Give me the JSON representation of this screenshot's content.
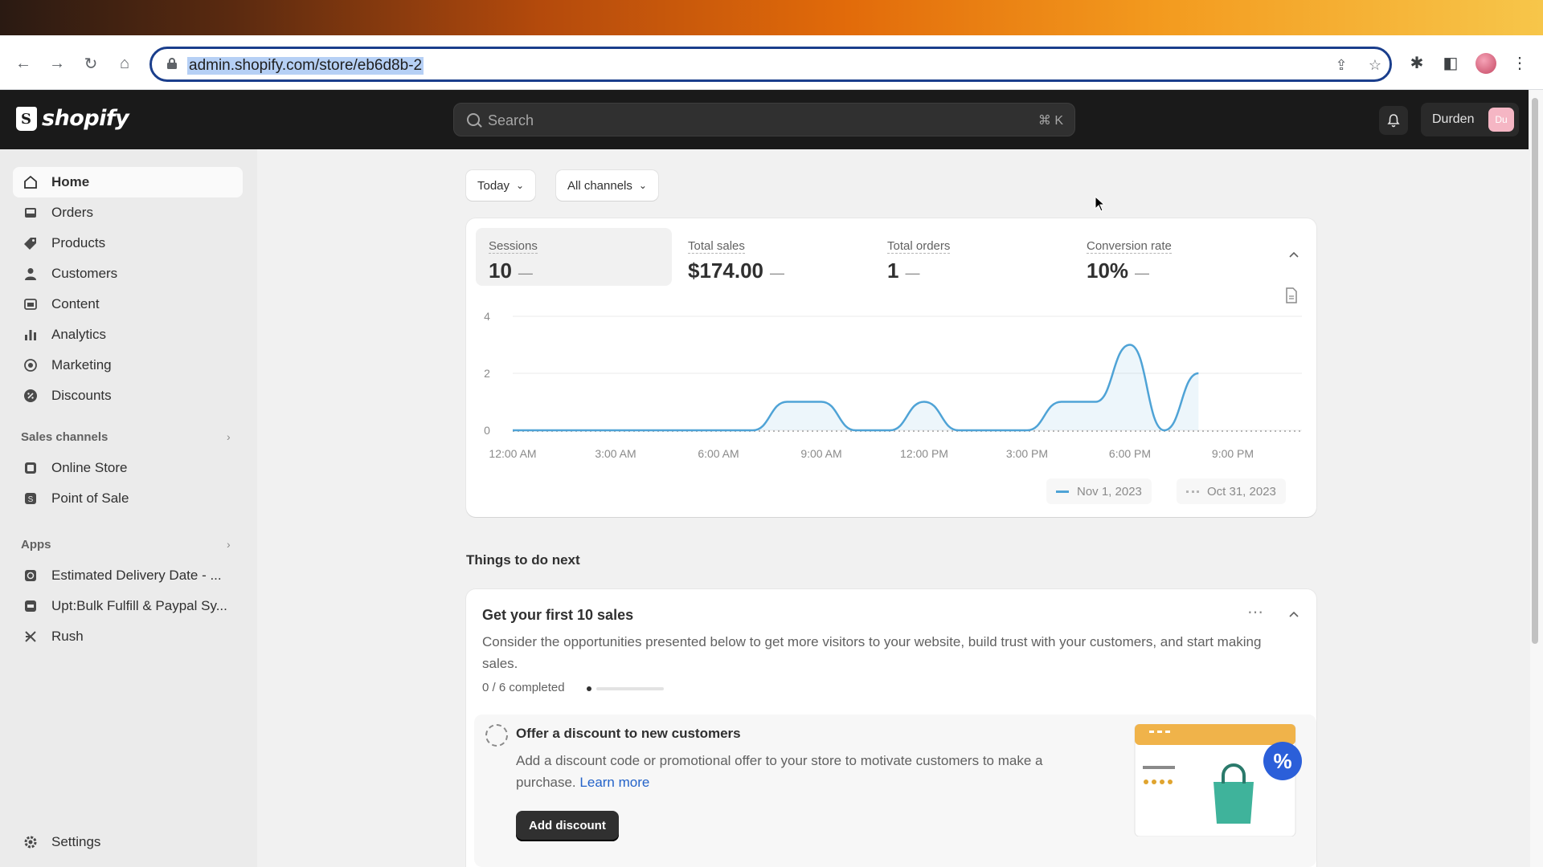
{
  "browser": {
    "url": "admin.shopify.com/store/eb6d8b-2"
  },
  "topbar": {
    "brand": "shopify",
    "search_placeholder": "Search",
    "search_shortcut": "⌘ K",
    "user_name": "Durden",
    "user_initials": "Du"
  },
  "sidebar": {
    "items": [
      {
        "label": "Home",
        "icon": "home-icon"
      },
      {
        "label": "Orders",
        "icon": "inbox-icon"
      },
      {
        "label": "Products",
        "icon": "tag-icon"
      },
      {
        "label": "Customers",
        "icon": "person-icon"
      },
      {
        "label": "Content",
        "icon": "content-icon"
      },
      {
        "label": "Analytics",
        "icon": "bar-chart-icon"
      },
      {
        "label": "Marketing",
        "icon": "target-icon"
      },
      {
        "label": "Discounts",
        "icon": "discount-icon"
      }
    ],
    "sales_channels_heading": "Sales channels",
    "sales_channels": [
      {
        "label": "Online Store",
        "icon": "store-icon"
      },
      {
        "label": "Point of Sale",
        "icon": "pos-icon"
      }
    ],
    "apps_heading": "Apps",
    "apps": [
      {
        "label": "Estimated Delivery Date - ...",
        "icon": "app-icon"
      },
      {
        "label": "Upt:Bulk Fulfill & Paypal Sy...",
        "icon": "app-icon"
      },
      {
        "label": "Rush",
        "icon": "rush-icon"
      }
    ],
    "settings": "Settings"
  },
  "filters": {
    "date": "Today",
    "channels": "All channels"
  },
  "metrics": [
    {
      "label": "Sessions",
      "value": "10",
      "trend": "—"
    },
    {
      "label": "Total sales",
      "value": "$174.00",
      "trend": "—"
    },
    {
      "label": "Total orders",
      "value": "1",
      "trend": "—"
    },
    {
      "label": "Conversion rate",
      "value": "10%",
      "trend": "—"
    }
  ],
  "chart_data": {
    "type": "line",
    "title": "",
    "xlabel": "",
    "ylabel": "",
    "x_ticks": [
      "12:00 AM",
      "3:00 AM",
      "6:00 AM",
      "9:00 AM",
      "12:00 PM",
      "3:00 PM",
      "6:00 PM",
      "9:00 PM"
    ],
    "y_ticks": [
      0,
      2,
      4
    ],
    "ylim": [
      0,
      4
    ],
    "xlim": [
      0,
      23
    ],
    "grid": true,
    "legend_position": "bottom-right",
    "series": [
      {
        "name": "Nov 1, 2023",
        "color": "#4fa3d6",
        "x": [
          0,
          1,
          2,
          3,
          4,
          5,
          6,
          7,
          8,
          9,
          10,
          11,
          12,
          13,
          14,
          15,
          16,
          17,
          18,
          19,
          20
        ],
        "values": [
          0,
          0,
          0,
          0,
          0,
          0,
          0,
          0,
          1,
          1,
          0,
          0,
          1,
          0,
          0,
          0,
          1,
          1,
          3,
          0,
          2
        ]
      },
      {
        "name": "Oct 31, 2023",
        "color": "#b5b5b5",
        "x": [
          0,
          23
        ],
        "values": [
          0,
          0
        ]
      }
    ]
  },
  "things_to_do": {
    "heading": "Things to do next",
    "card_title": "Get your first 10 sales",
    "card_description": "Consider the opportunities presented below to get more visitors to your website, build trust with your customers, and start making sales.",
    "progress_text": "0 / 6 completed",
    "progress_fraction": 0,
    "task": {
      "title": "Offer a discount to new customers",
      "description": "Add a discount code or promotional offer to your store to motivate customers to make a purchase.",
      "link": "Learn more",
      "button": "Add discount"
    }
  }
}
